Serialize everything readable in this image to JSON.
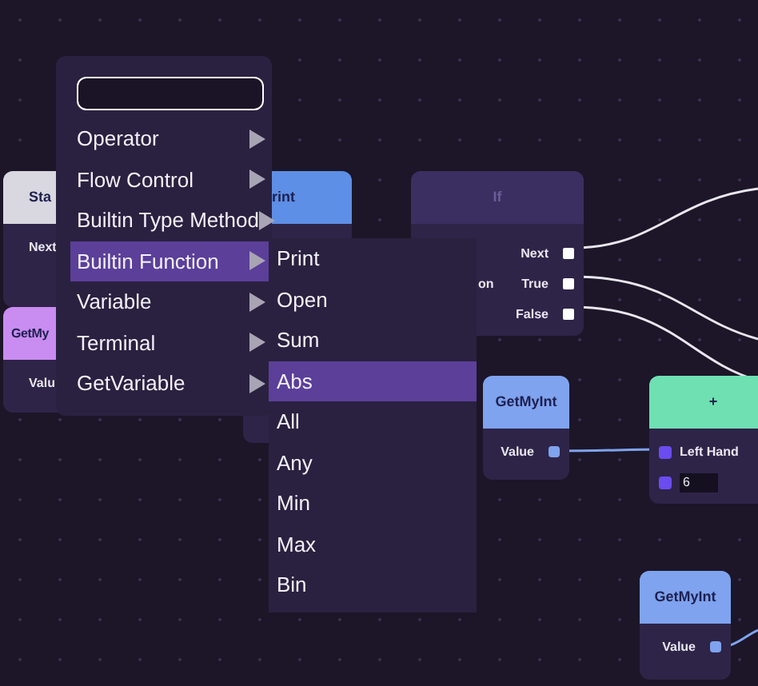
{
  "nodes": [
    {
      "title": "Sta",
      "color": "#d9d7df",
      "rows": [
        {
          "left": "Next"
        }
      ]
    },
    {
      "title": "GetMy",
      "color": "#c98cf0",
      "rows": [
        {
          "left": "Valu"
        }
      ]
    },
    {
      "title": "rint",
      "color": "#5d8fe6"
    },
    {
      "title": "If",
      "color": "#3b2e60",
      "rows": [
        {
          "right": "Next",
          "kind": "exec"
        },
        {
          "left": "on",
          "right": "True",
          "kind": "exec"
        },
        {
          "right": "False",
          "kind": "exec"
        }
      ]
    },
    {
      "title": "GetMyInt",
      "color": "#7fa3ee",
      "rows": [
        {
          "right": "Value",
          "kind": "value"
        }
      ]
    },
    {
      "title": "+",
      "color": "#6fe0b2",
      "rows": [
        {
          "left": "Left Hand",
          "kind": "input"
        },
        {
          "input": "6",
          "kind": "input"
        }
      ]
    },
    {
      "title": "GetMyInt",
      "color": "#7fa3ee",
      "rows": [
        {
          "right": "Value",
          "kind": "value"
        }
      ]
    }
  ],
  "menu": {
    "items": [
      {
        "label": "Operator",
        "selected": false
      },
      {
        "label": "Flow Control",
        "selected": false
      },
      {
        "label": "Builtin Type Method",
        "selected": false
      },
      {
        "label": "Builtin Function",
        "selected": true
      },
      {
        "label": "Variable",
        "selected": false
      },
      {
        "label": "Terminal",
        "selected": false
      },
      {
        "label": "GetVariable",
        "selected": false
      }
    ]
  },
  "submenu": {
    "items": [
      {
        "label": "Print",
        "selected": false
      },
      {
        "label": "Open",
        "selected": false
      },
      {
        "label": "Sum",
        "selected": false
      },
      {
        "label": "Abs",
        "selected": true
      },
      {
        "label": "All",
        "selected": false
      },
      {
        "label": "Any",
        "selected": false
      },
      {
        "label": "Min",
        "selected": false
      },
      {
        "label": "Max",
        "selected": false
      },
      {
        "label": "Bin",
        "selected": false
      }
    ]
  }
}
